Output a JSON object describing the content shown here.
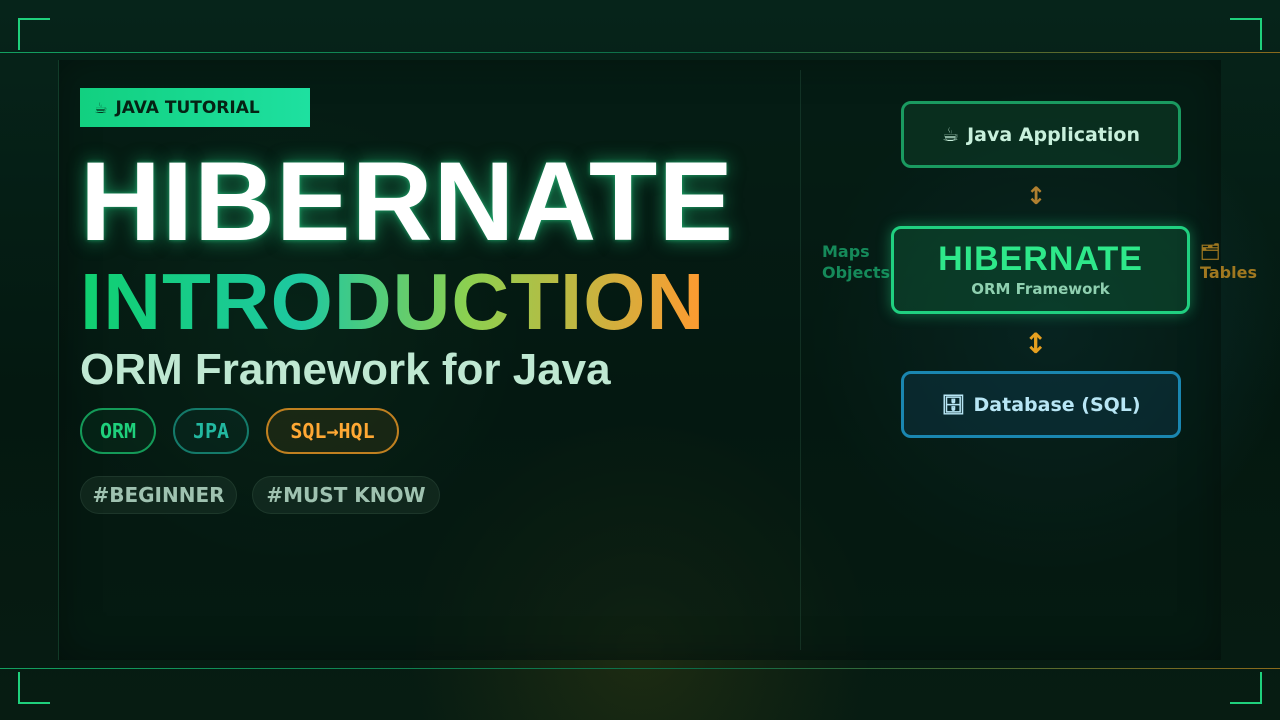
{
  "badge": {
    "icon": "☕",
    "label": "JAVA TUTORIAL"
  },
  "title": "HIBERNATE",
  "subtitle": "INTRODUCTION",
  "tagline": "ORM Framework for Java",
  "chips": [
    "ORM",
    "JPA",
    "SQL→HQL"
  ],
  "tags": [
    "#BEGINNER",
    "#MUST KNOW"
  ],
  "diagram": {
    "top": {
      "icon": "☕",
      "label": "Java Application"
    },
    "middle": {
      "title": "HIBERNATE",
      "subtitle": "ORM Framework"
    },
    "bottom": {
      "icon": "🗄",
      "label": "Database (SQL)"
    },
    "arrow_top": "↕",
    "arrow_bottom": "↕",
    "left_note": [
      "Maps",
      "Objects"
    ],
    "right_note": [
      "🗂",
      "Tables"
    ]
  },
  "colors": {
    "accent_green": "#20d080",
    "accent_orange": "#ffa834",
    "accent_blue": "#1a86b0",
    "background": "#041810"
  }
}
